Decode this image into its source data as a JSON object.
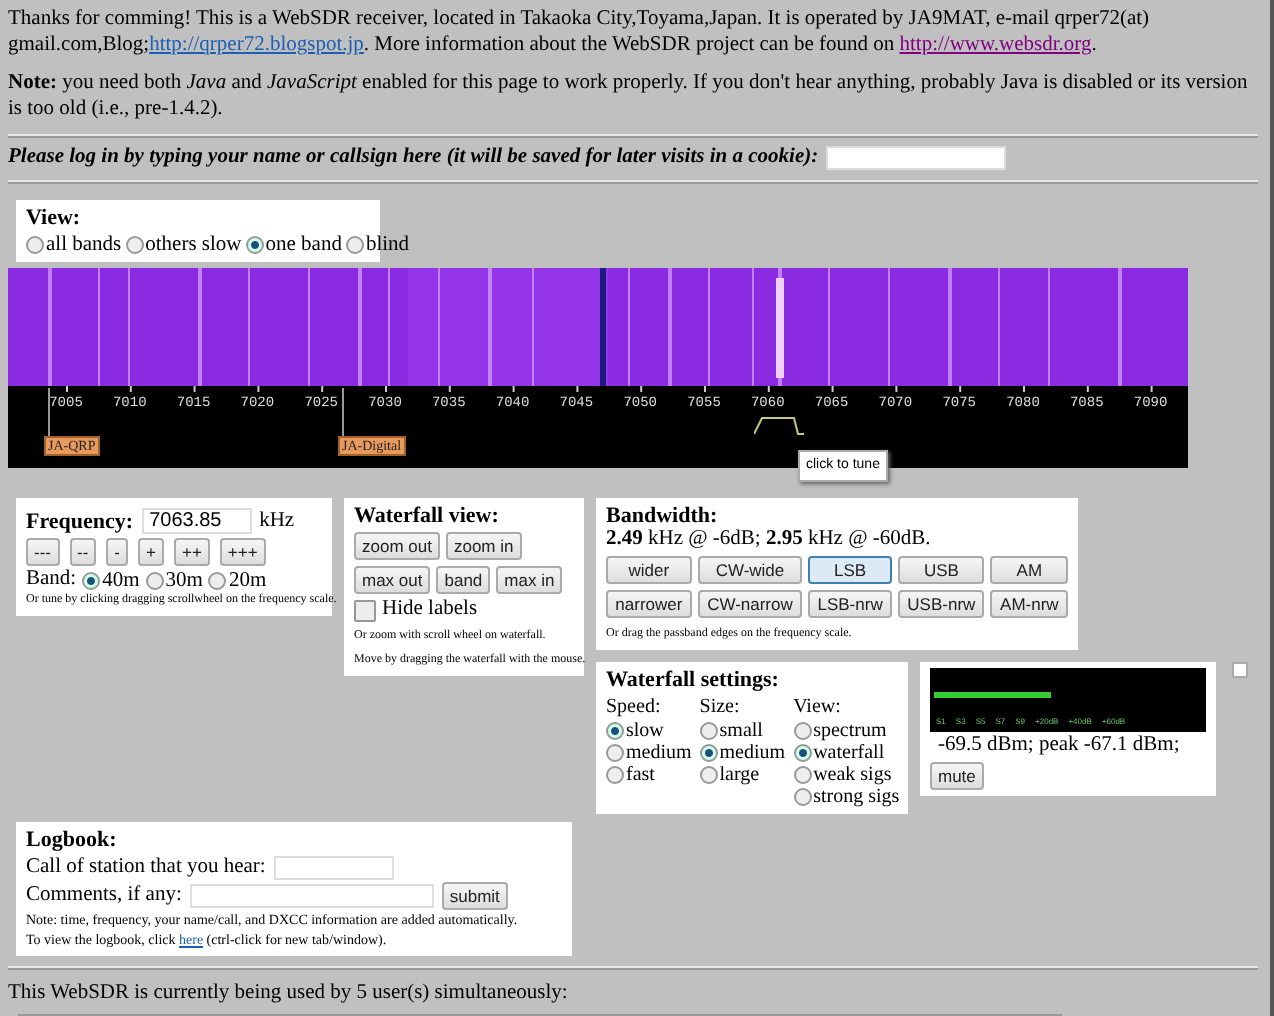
{
  "intro": [
    {
      "kind": "text",
      "text": "Thanks for comming! This is a WebSDR receiver, located in Takaoka City,Toyama,Japan. It is operated by JA9MAT, e-mail qrper72(at) gmail.com,Blog;"
    },
    {
      "kind": "link",
      "text": "http://qrper72.blogspot.jp",
      "visited": false
    },
    {
      "kind": "text",
      "text": ". More information about the WebSDR project can be found on "
    },
    {
      "kind": "link",
      "text": "http://www.websdr.org",
      "visited": true
    },
    {
      "kind": "text",
      "text": "."
    }
  ],
  "note": "**Note:** you need both *Java* and *JavaScript* enabled for this page to work properly. If you don't hear anything, probably Java is disabled or its version is too old (i.e., pre-1.4.2).",
  "login": {
    "prompt": "Please log in by typing your name or callsign here (it will be saved for later visits in a cookie):"
  },
  "view": {
    "title": "View:",
    "options": [
      {
        "label": "all bands",
        "selected": false
      },
      {
        "label": "others slow",
        "selected": false
      },
      {
        "label": "one band",
        "selected": true
      },
      {
        "label": "blind",
        "selected": false
      }
    ]
  },
  "waterfall": {
    "scale": [
      "7005",
      "7010",
      "7015",
      "7020",
      "7025",
      "7030",
      "7035",
      "7040",
      "7045",
      "7050",
      "7055",
      "7060",
      "7065",
      "7070",
      "7075",
      "7080",
      "7085",
      "7090"
    ],
    "labels": [
      {
        "text": "JA-QRP"
      },
      {
        "text": "JA-Digital"
      }
    ],
    "tooltip": "click to tune"
  },
  "frequency": {
    "title": "Frequency:",
    "value": "7063.85",
    "unit": "kHz",
    "step_buttons": [
      "---",
      "--",
      "-",
      "+",
      "++",
      "+++"
    ],
    "band_label": "Band:",
    "bands": [
      {
        "label": "40m",
        "selected": true
      },
      {
        "label": "30m",
        "selected": false
      },
      {
        "label": "20m",
        "selected": false
      }
    ],
    "hint": "Or tune by clicking dragging scrollwheel on the frequency scale."
  },
  "waterfall_view": {
    "title": "Waterfall view:",
    "buttons": [
      "zoom out",
      "zoom in",
      "max out",
      "band",
      "max in"
    ],
    "hide_labels": {
      "label": "Hide labels",
      "checked": false
    },
    "hints": [
      "Or zoom with scroll wheel on waterfall.",
      "Move by dragging the waterfall with the mouse."
    ]
  },
  "bandwidth": {
    "title": "Bandwidth:",
    "reading": "**2.49** kHz @ -6dB; **2.95** kHz @ -60dB.",
    "buttons": [
      {
        "label": "wider",
        "selected": false
      },
      {
        "label": "CW-wide",
        "selected": false
      },
      {
        "label": "LSB",
        "selected": true
      },
      {
        "label": "USB",
        "selected": false
      },
      {
        "label": "AM",
        "selected": false
      },
      {
        "label": "narrower",
        "selected": false
      },
      {
        "label": "CW-narrow",
        "selected": false
      },
      {
        "label": "LSB-nrw",
        "selected": false
      },
      {
        "label": "USB-nrw",
        "selected": false
      },
      {
        "label": "AM-nrw",
        "selected": false
      }
    ],
    "hint": "Or drag the passband edges on the frequency scale."
  },
  "waterfall_settings": {
    "title": "Waterfall settings:",
    "groups": [
      {
        "title": "Speed:",
        "options": [
          {
            "label": "slow",
            "selected": true
          },
          {
            "label": "medium",
            "selected": false
          },
          {
            "label": "fast",
            "selected": false
          }
        ]
      },
      {
        "title": "Size:",
        "options": [
          {
            "label": "small",
            "selected": false
          },
          {
            "label": "medium",
            "selected": true
          },
          {
            "label": "large",
            "selected": false
          }
        ]
      },
      {
        "title": "View:",
        "options": [
          {
            "label": "spectrum",
            "selected": false
          },
          {
            "label": "waterfall",
            "selected": true
          },
          {
            "label": "weak sigs",
            "selected": false
          },
          {
            "label": "strong sigs",
            "selected": false
          }
        ]
      }
    ]
  },
  "side_checkbox": {
    "checked": false
  },
  "meter": {
    "level": 0.45,
    "scale": [
      "S1",
      "S3",
      "S5",
      "S7",
      "S9",
      "+20dB",
      "+40dB",
      "+60dB"
    ],
    "reading": "-69.5 dBm; peak  -67.1 dBm;",
    "mute": "mute"
  },
  "logbook": {
    "title": "Logbook:",
    "call_label": "Call of station that you hear:",
    "comments_label": "Comments, if any:",
    "submit": "submit",
    "note": "Note: time, frequency, your name/call, and DXCC information are added automatically.",
    "view_before": "To view the logbook, click ",
    "view_link": "here",
    "view_after": " (ctrl-click for new tab/window)."
  },
  "users": "This WebSDR is currently being used by 5 user(s) simultaneously:"
}
